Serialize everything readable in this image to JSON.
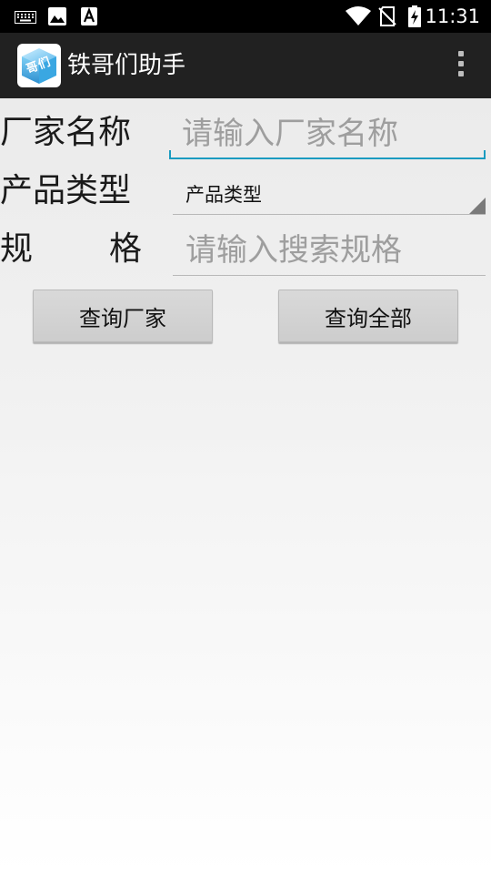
{
  "status_bar": {
    "time": "11:31",
    "icons": [
      "keyboard-icon",
      "image-icon",
      "font-download-icon",
      "wifi-icon",
      "no-sim-icon",
      "battery-charging-icon"
    ]
  },
  "action_bar": {
    "app_icon": "app-logo-icon",
    "app_icon_text": "哥们",
    "title": "铁哥们助手",
    "overflow_icon": "overflow-menu-icon"
  },
  "form": {
    "manufacturer_label": "厂家名称",
    "manufacturer_placeholder": "请输入厂家名称",
    "manufacturer_value": "",
    "product_type_label": "产品类型",
    "product_type_selected": "产品类型",
    "spec_label_left": "规",
    "spec_label_right": "格",
    "spec_placeholder": "请输入搜索规格",
    "spec_value": ""
  },
  "buttons": {
    "query_manufacturer": "查询厂家",
    "query_all": "查询全部"
  },
  "colors": {
    "status_bar": "#000000",
    "action_bar": "#212121",
    "focus_underline": "#1a9bc0",
    "input_underline": "#b8b8b8",
    "button_bg": "#d4d4d4"
  }
}
